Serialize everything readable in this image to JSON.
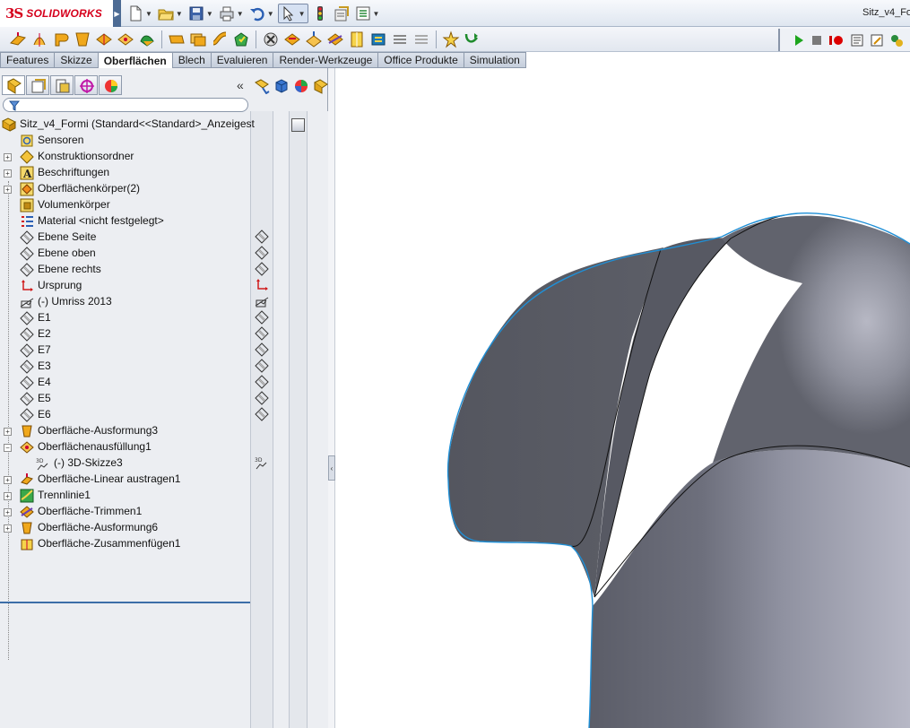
{
  "app": {
    "brand_prefix": "3S",
    "brand_name": "SOLIDWORKS",
    "document_title": "Sitz_v4_Fo"
  },
  "quick_access": [
    {
      "name": "new-document",
      "icon": "new-file-icon"
    },
    {
      "name": "open-document",
      "icon": "open-folder-icon"
    },
    {
      "name": "save-document",
      "icon": "save-icon"
    },
    {
      "name": "print",
      "icon": "printer-icon"
    },
    {
      "name": "undo",
      "icon": "undo-icon"
    },
    {
      "name": "select",
      "icon": "cursor-icon"
    },
    {
      "name": "rebuild",
      "icon": "traffic-light-icon"
    },
    {
      "name": "file-properties",
      "icon": "properties-icon"
    },
    {
      "name": "options",
      "icon": "options-icon"
    }
  ],
  "tabs": [
    {
      "label": "Features",
      "active": false
    },
    {
      "label": "Skizze",
      "active": false
    },
    {
      "label": "Oberflächen",
      "active": true
    },
    {
      "label": "Blech",
      "active": false
    },
    {
      "label": "Evaluieren",
      "active": false
    },
    {
      "label": "Render-Werkzeuge",
      "active": false
    },
    {
      "label": "Office Produkte",
      "active": false
    },
    {
      "label": "Simulation",
      "active": false
    }
  ],
  "tree": {
    "root_label": "Sitz_v4_Formi  (Standard<<Standard>_Anzeigest",
    "items": [
      {
        "label": "Sensoren",
        "icon": "sensor-icon",
        "expandable": false
      },
      {
        "label": "Konstruktionsordner",
        "icon": "annotation-folder-icon",
        "expandable": true
      },
      {
        "label": "Beschriftungen",
        "icon": "annotation-a-icon",
        "expandable": true
      },
      {
        "label": "Oberflächenkörper(2)",
        "icon": "surface-bodies-icon",
        "expandable": true
      },
      {
        "label": "Volumenkörper",
        "icon": "solid-bodies-icon",
        "expandable": false
      },
      {
        "label": "Material <nicht festgelegt>",
        "icon": "material-icon",
        "expandable": false
      },
      {
        "label": "Ebene Seite",
        "icon": "plane-icon",
        "expandable": false
      },
      {
        "label": "Ebene oben",
        "icon": "plane-icon",
        "expandable": false
      },
      {
        "label": "Ebene rechts",
        "icon": "plane-icon",
        "expandable": false
      },
      {
        "label": "Ursprung",
        "icon": "origin-icon",
        "expandable": false
      },
      {
        "label": "(-) Umriss 2013",
        "icon": "sketch-icon",
        "expandable": false
      },
      {
        "label": "E1",
        "icon": "plane-icon",
        "expandable": false
      },
      {
        "label": "E2",
        "icon": "plane-icon",
        "expandable": false
      },
      {
        "label": "E7",
        "icon": "plane-icon",
        "expandable": false
      },
      {
        "label": "E3",
        "icon": "plane-icon",
        "expandable": false
      },
      {
        "label": "E4",
        "icon": "plane-icon",
        "expandable": false
      },
      {
        "label": "E5",
        "icon": "plane-icon",
        "expandable": false
      },
      {
        "label": "E6",
        "icon": "plane-icon",
        "expandable": false
      },
      {
        "label": "Oberfläche-Ausformung3",
        "icon": "surface-loft-icon",
        "expandable": true
      },
      {
        "label": "Oberflächenausfüllung1",
        "icon": "surface-fill-icon",
        "expandable": true,
        "expanded": true
      },
      {
        "label": "(-) 3D-Skizze3",
        "icon": "3d-sketch-icon",
        "expandable": false,
        "child": true
      },
      {
        "label": "Oberfläche-Linear austragen1",
        "icon": "surface-extrude-icon",
        "expandable": true
      },
      {
        "label": "Trennlinie1",
        "icon": "split-line-icon",
        "expandable": true
      },
      {
        "label": "Oberfläche-Trimmen1",
        "icon": "surface-trim-icon",
        "expandable": true
      },
      {
        "label": "Oberfläche-Ausformung6",
        "icon": "surface-loft-icon",
        "expandable": true
      },
      {
        "label": "Oberfläche-Zusammenfügen1",
        "icon": "surface-knit-icon",
        "expandable": false
      }
    ]
  },
  "colors": {
    "accent": "#3c6ea8",
    "model_surface": "#5a5c66",
    "model_edge": "#1f8fd6"
  }
}
